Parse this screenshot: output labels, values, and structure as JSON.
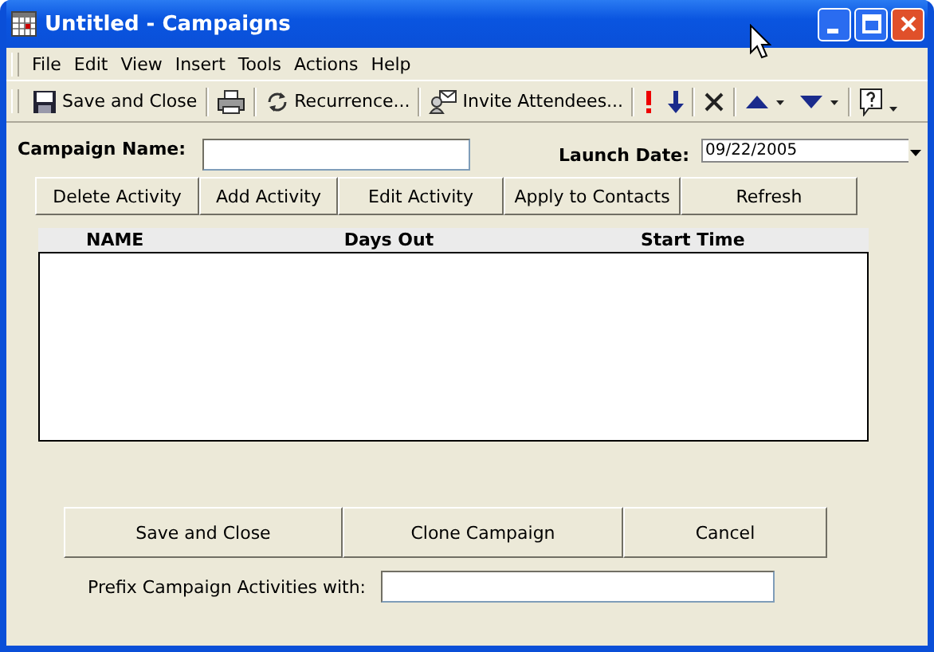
{
  "window": {
    "title": "Untitled - Campaigns"
  },
  "menu": [
    "File",
    "Edit",
    "View",
    "Insert",
    "Tools",
    "Actions",
    "Help"
  ],
  "toolbar": [
    {
      "kind": "save",
      "label": "Save and Close"
    },
    {
      "kind": "print"
    },
    {
      "kind": "recurrence",
      "label": "Recurrence..."
    },
    {
      "kind": "invite",
      "label": "Invite Attendees..."
    },
    {
      "kind": "high"
    },
    {
      "kind": "low"
    },
    {
      "kind": "delete"
    },
    {
      "kind": "up"
    },
    {
      "kind": "down"
    },
    {
      "kind": "help"
    }
  ],
  "campaign_name": {
    "label": "Campaign Name:"
  },
  "launch_date": {
    "label": "Launch Date:",
    "value": "09/22/2005"
  },
  "actions": [
    "Delete Activity",
    "Add Activity",
    "Edit Activity",
    "Apply to Contacts",
    "Refresh"
  ],
  "table": {
    "columns": [
      "NAME",
      "Days Out",
      "Start Time"
    ]
  },
  "buttons": [
    "Save and Close",
    "Clone Campaign",
    "Cancel"
  ],
  "prefix": {
    "label": "Prefix Campaign Activities with:"
  }
}
